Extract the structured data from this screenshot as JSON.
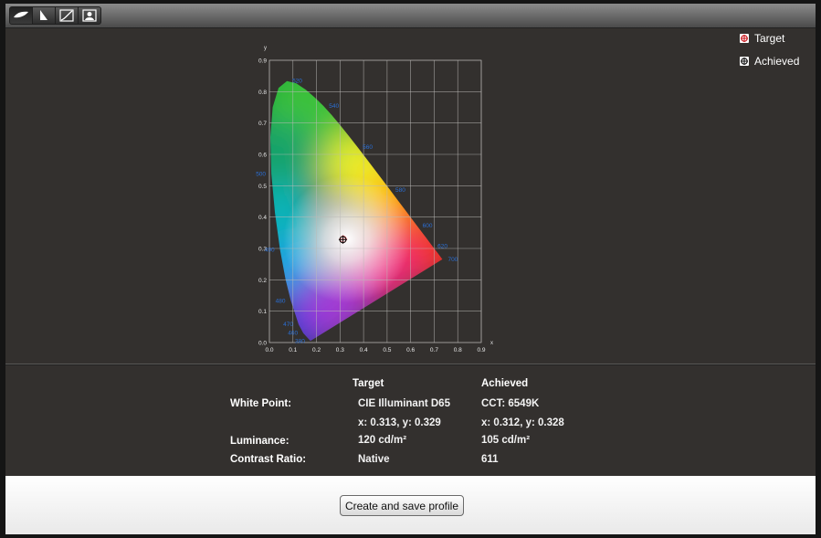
{
  "toolbar": {
    "buttons": [
      {
        "icon": "display-icon",
        "active": true
      },
      {
        "icon": "gamut-icon",
        "active": false
      },
      {
        "icon": "curve-icon",
        "active": false
      },
      {
        "icon": "profile-image-icon",
        "active": false
      }
    ]
  },
  "legend": {
    "target_label": "Target",
    "achieved_label": "Achieved"
  },
  "chart_data": {
    "type": "scatter",
    "xlabel": "x",
    "ylabel": "y",
    "xlim": [
      0,
      0.9
    ],
    "ylim": [
      0,
      0.9
    ],
    "x_ticks": [
      "0.0",
      "0.1",
      "0.2",
      "0.3",
      "0.4",
      "0.5",
      "0.6",
      "0.7",
      "0.8",
      "0.9"
    ],
    "y_ticks": [
      "0.0",
      "0.1",
      "0.2",
      "0.3",
      "0.4",
      "0.5",
      "0.6",
      "0.7",
      "0.8",
      "0.9"
    ],
    "wavelength_labels": [
      {
        "text": "520",
        "x": 0.074,
        "y": 0.834
      },
      {
        "text": "540",
        "x": 0.23,
        "y": 0.754
      },
      {
        "text": "560",
        "x": 0.373,
        "y": 0.624
      },
      {
        "text": "580",
        "x": 0.512,
        "y": 0.487
      },
      {
        "text": "600",
        "x": 0.627,
        "y": 0.373
      },
      {
        "text": "620",
        "x": 0.691,
        "y": 0.308
      },
      {
        "text": "700",
        "x": 0.735,
        "y": 0.265
      },
      {
        "text": "500",
        "x": 0.008,
        "y": 0.538
      },
      {
        "text": "490",
        "x": 0.045,
        "y": 0.295
      },
      {
        "text": "480",
        "x": 0.091,
        "y": 0.133
      },
      {
        "text": "470",
        "x": 0.124,
        "y": 0.058
      },
      {
        "text": "460",
        "x": 0.144,
        "y": 0.03
      },
      {
        "text": "380",
        "x": 0.174,
        "y": 0.005
      }
    ],
    "spectral_locus": [
      [
        0.1741,
        0.005
      ],
      [
        0.144,
        0.0297
      ],
      [
        0.1241,
        0.0578
      ],
      [
        0.0913,
        0.1327
      ],
      [
        0.0687,
        0.2007
      ],
      [
        0.0454,
        0.295
      ],
      [
        0.0235,
        0.4127
      ],
      [
        0.0082,
        0.5384
      ],
      [
        0.0039,
        0.6548
      ],
      [
        0.0139,
        0.7502
      ],
      [
        0.0389,
        0.812
      ],
      [
        0.0743,
        0.8338
      ],
      [
        0.1142,
        0.8262
      ],
      [
        0.1547,
        0.8059
      ],
      [
        0.1929,
        0.7816
      ],
      [
        0.2296,
        0.7543
      ],
      [
        0.2658,
        0.7243
      ],
      [
        0.3016,
        0.6923
      ],
      [
        0.3373,
        0.6589
      ],
      [
        0.3731,
        0.6245
      ],
      [
        0.4087,
        0.5896
      ],
      [
        0.4441,
        0.5547
      ],
      [
        0.4788,
        0.5202
      ],
      [
        0.5125,
        0.4866
      ],
      [
        0.5448,
        0.4544
      ],
      [
        0.5752,
        0.4242
      ],
      [
        0.6029,
        0.3965
      ],
      [
        0.627,
        0.3725
      ],
      [
        0.6482,
        0.3514
      ],
      [
        0.6658,
        0.334
      ],
      [
        0.6801,
        0.3197
      ],
      [
        0.6915,
        0.3083
      ],
      [
        0.7006,
        0.2993
      ],
      [
        0.714,
        0.2859
      ],
      [
        0.7347,
        0.2653
      ]
    ],
    "points": [
      {
        "name": "Target",
        "x": 0.313,
        "y": 0.329
      },
      {
        "name": "Achieved",
        "x": 0.312,
        "y": 0.328
      }
    ]
  },
  "summary": {
    "col_target": "Target",
    "col_achieved": "Achieved",
    "white_point_label": "White Point:",
    "white_point_target": "CIE Illuminant D65",
    "white_point_achieved": "CCT: 6549K",
    "white_point_target_xy": "x: 0.313, y: 0.329",
    "white_point_achieved_xy": "x: 0.312, y: 0.328",
    "luminance_label": "Luminance:",
    "luminance_target": "120 cd/m²",
    "luminance_achieved": "105 cd/m²",
    "contrast_label": "Contrast Ratio:",
    "contrast_target": "Native",
    "contrast_achieved": "611"
  },
  "footer": {
    "create_button": "Create and save profile"
  }
}
